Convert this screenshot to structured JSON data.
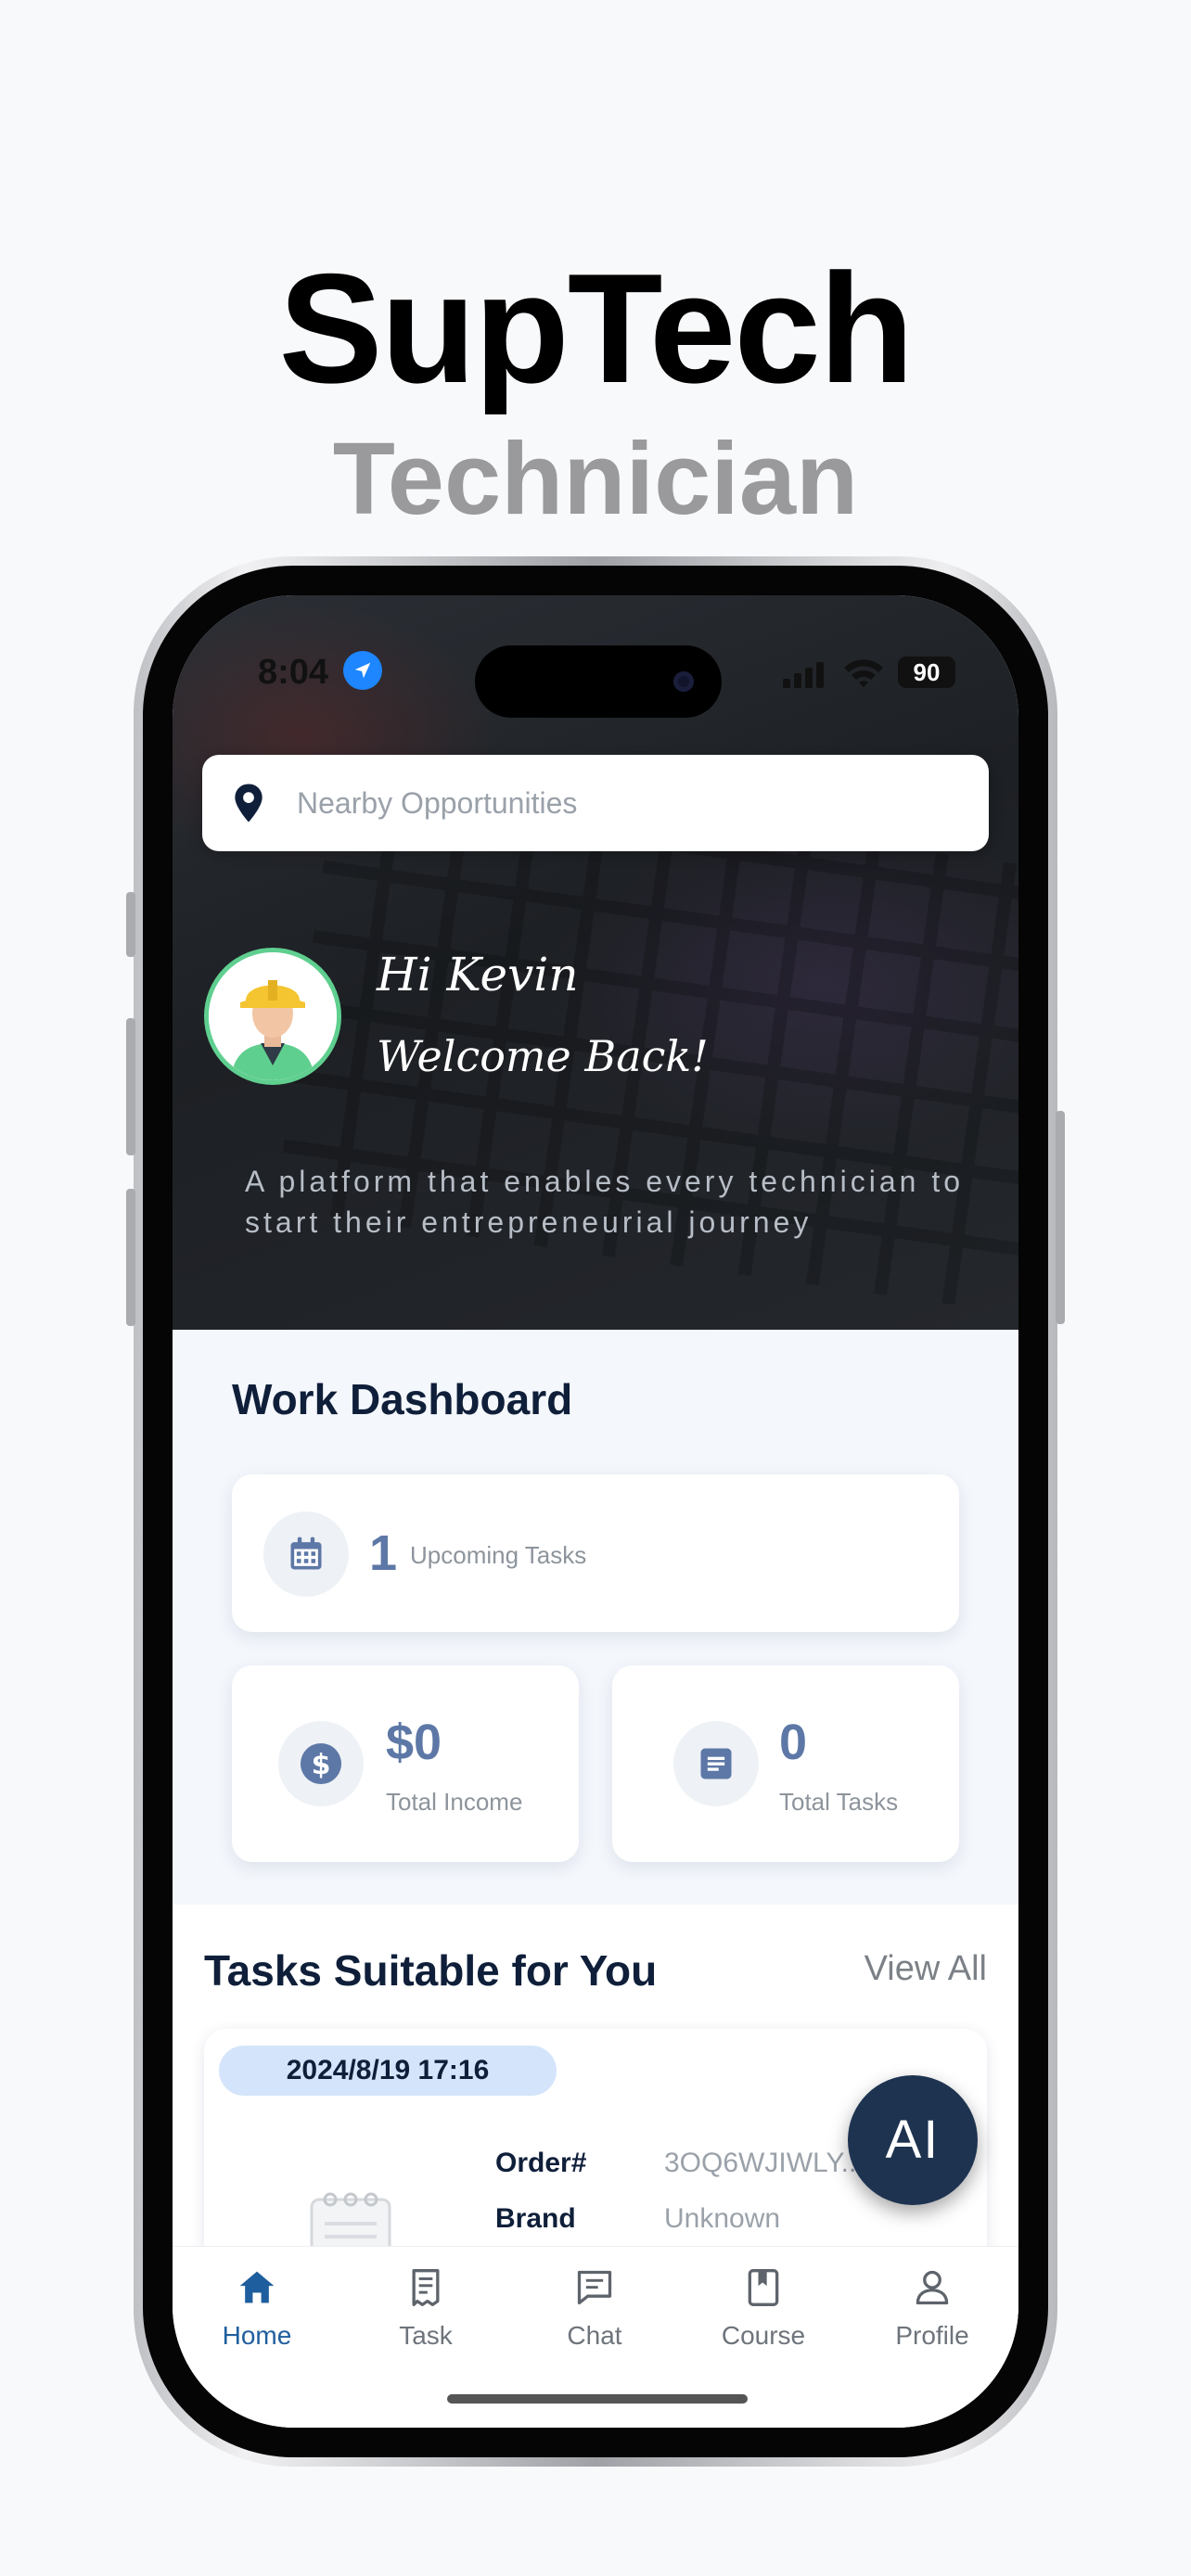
{
  "promo": {
    "title": "SupTech",
    "subtitle": "Technician"
  },
  "status_bar": {
    "time": "8:04",
    "battery": "90"
  },
  "search": {
    "placeholder": "Nearby Opportunities"
  },
  "hero": {
    "greeting": "Hi Kevin",
    "welcome": "Welcome Back!",
    "tagline": "A platform that enables every technician to start their entrepreneurial journey"
  },
  "dashboard": {
    "title": "Work Dashboard",
    "upcoming": {
      "value": "1",
      "label": "Upcoming Tasks"
    },
    "income": {
      "value": "$0",
      "label": "Total Income"
    },
    "tasks": {
      "value": "0",
      "label": "Total Tasks"
    }
  },
  "suitable": {
    "title": "Tasks Suitable for You",
    "view_all": "View All",
    "card": {
      "date": "2024/8/19 17:16",
      "order_label": "Order#",
      "order_value": "3OQ6WJIWLY...",
      "brand_label": "Brand",
      "brand_value": "Unknown"
    }
  },
  "ai_button": "AI",
  "tabs": [
    {
      "label": "Home",
      "icon": "home-icon"
    },
    {
      "label": "Task",
      "icon": "task-icon"
    },
    {
      "label": "Chat",
      "icon": "chat-icon"
    },
    {
      "label": "Course",
      "icon": "course-icon"
    },
    {
      "label": "Profile",
      "icon": "profile-icon"
    }
  ],
  "colors": {
    "accent": "#1f5e9e",
    "stat_number": "#5d78a6",
    "date_pill": "#d4e4fb",
    "ai_fab": "#1e3350",
    "avatar_ring": "#5fcf8f"
  }
}
